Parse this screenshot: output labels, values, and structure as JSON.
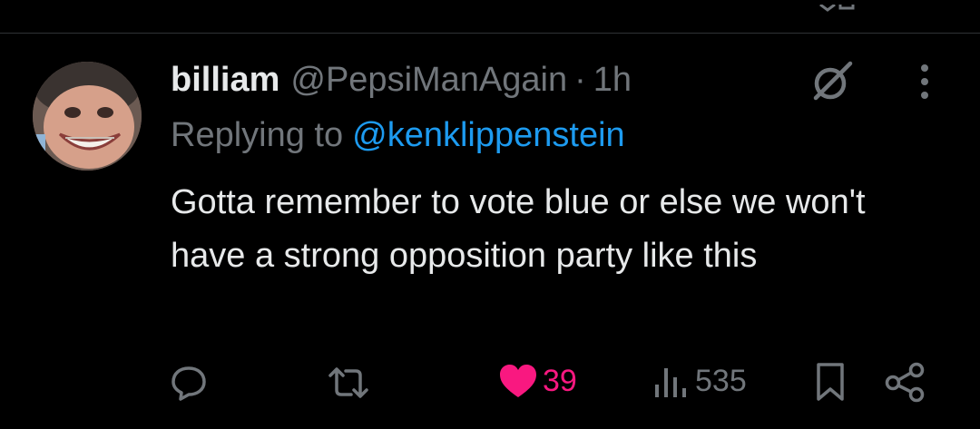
{
  "tweet": {
    "display_name": "billiam",
    "handle": "@PepsiManAgain",
    "separator": "·",
    "time": "1h",
    "replying_prefix": "Replying to",
    "replying_handle": "@kenklippenstein",
    "text": "Gotta remember to vote blue or else we won't have a strong opposition party like this"
  },
  "actions": {
    "reply_count": "",
    "retweet_count": "",
    "like_count": "39",
    "views_count": "535"
  },
  "icons": {
    "grok": "grok-icon",
    "more": "more-dots-icon",
    "reply": "reply-bubble-icon",
    "retweet": "retweet-icon",
    "like": "heart-icon",
    "views": "views-bars-icon",
    "bookmark": "bookmark-icon",
    "share": "share-icon"
  },
  "colors": {
    "background": "#000000",
    "primary_text": "#e7e9ea",
    "secondary_text": "#71767b",
    "link": "#1d9bf0",
    "like": "#f91880"
  }
}
